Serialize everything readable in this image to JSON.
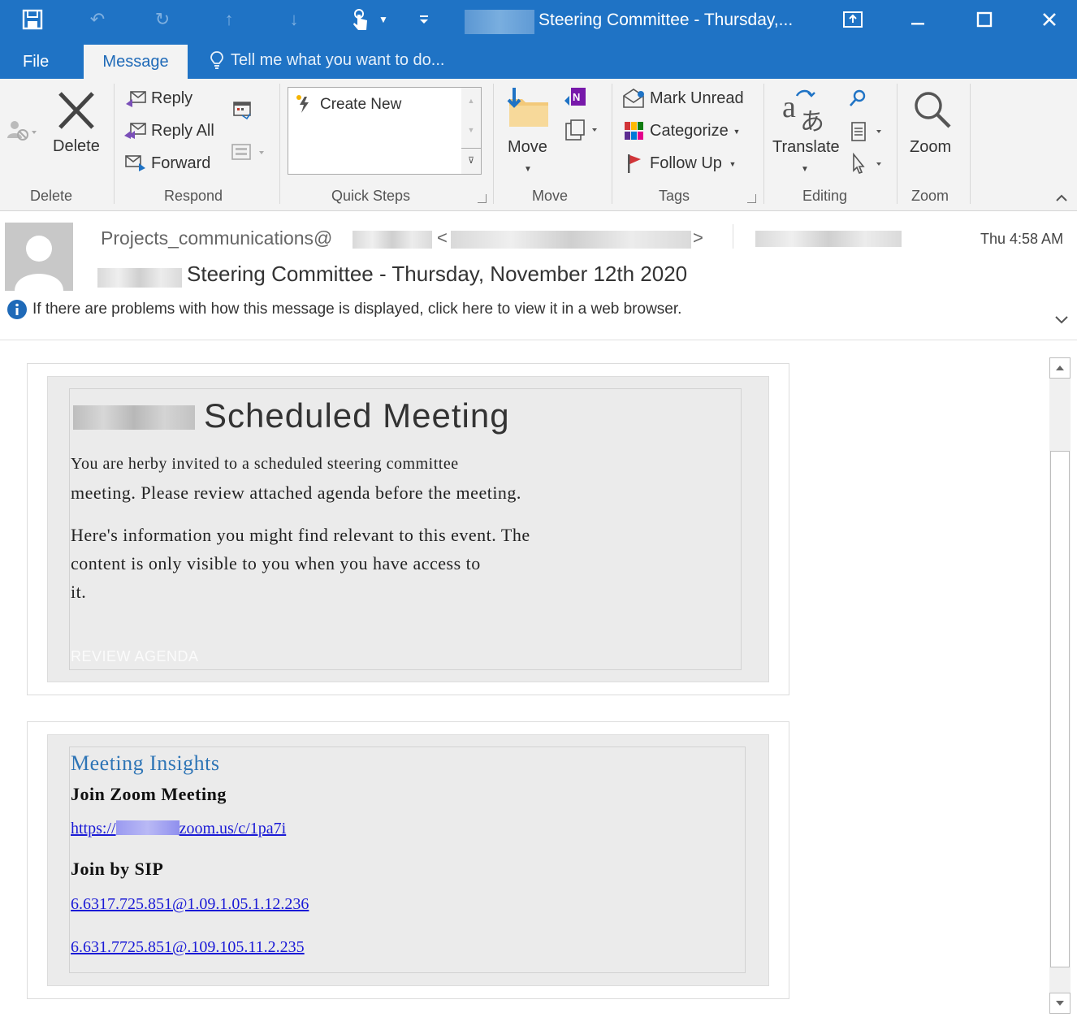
{
  "window": {
    "title": "Steering Committee - Thursday,..."
  },
  "tabs": {
    "file": "File",
    "message": "Message",
    "tell_me": "Tell me what you want to do..."
  },
  "ribbon": {
    "delete": {
      "button": "Delete",
      "group": "Delete"
    },
    "respond": {
      "reply": "Reply",
      "reply_all": "Reply All",
      "forward": "Forward",
      "group": "Respond"
    },
    "quick_steps": {
      "create_new": "Create New",
      "group": "Quick Steps"
    },
    "move": {
      "button": "Move",
      "group": "Move"
    },
    "tags": {
      "mark_unread": "Mark Unread",
      "categorize": "Categorize",
      "follow_up": "Follow Up",
      "group": "Tags"
    },
    "editing": {
      "translate": "Translate",
      "group": "Editing"
    },
    "zoom": {
      "button": "Zoom",
      "group": "Zoom"
    }
  },
  "message": {
    "sender": "Projects_communications@",
    "sender_open": "<",
    "sender_close": ">",
    "time": "Thu 4:58 AM",
    "subject": "Steering Committee - Thursday, November 12th 2020",
    "info": "If there are problems with how this message is displayed, click here to view it in a web browser."
  },
  "email": {
    "heading": "Scheduled Meeting",
    "para1_line1": "You are herby invited to a scheduled steering committee",
    "para1_line2": "meeting.  Please review attached agenda before the meeting.",
    "para2_line1": "Here's information you might find relevant to this event. The",
    "para2_line2": "content is only visible to you when you have access to",
    "para2_line3": "it.",
    "review_link": "REVIEW AGENDA",
    "insights_title": "Meeting Insights",
    "zoom_heading": "Join Zoom Meeting",
    "zoom_link_prefix": "https://",
    "zoom_link_suffix": "zoom.us/c/1pa7i",
    "sip_heading": "Join by SIP",
    "sip_link1": "6.6317.725.851@1.09.1.05.1.12.236",
    "sip_link2": "6.631.7725.851@.109.105.11.2.235"
  }
}
